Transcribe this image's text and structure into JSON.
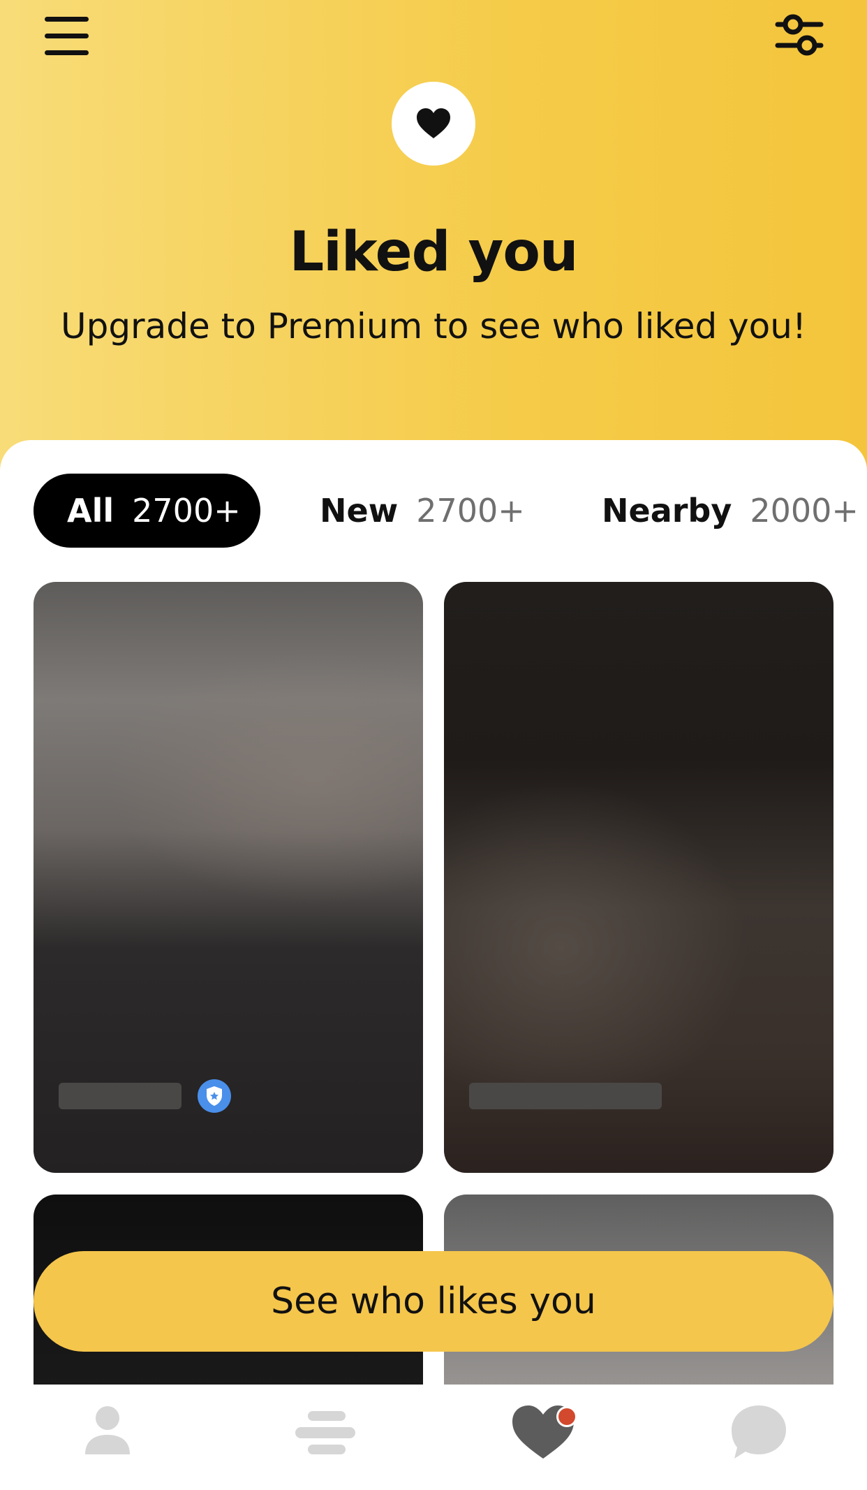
{
  "header": {
    "title": "Liked you",
    "subtitle": "Upgrade to Premium to see who liked you!",
    "menu_icon": "hamburger-menu-icon",
    "filter_icon": "sliders-filter-icon",
    "heart_icon": "heart-icon"
  },
  "tabs": [
    {
      "label": "All",
      "count": "2700+",
      "active": true
    },
    {
      "label": "New",
      "count": "2700+",
      "active": false
    },
    {
      "label": "Nearby",
      "count": "2000+",
      "active": false
    }
  ],
  "cards": [
    {
      "blurred": true,
      "verified": true
    },
    {
      "blurred": true,
      "verified": false
    },
    {
      "blurred": true,
      "verified": false
    },
    {
      "blurred": true,
      "verified": false
    }
  ],
  "cta": {
    "label": "See who likes you"
  },
  "bottom_nav": [
    {
      "icon": "profile-icon"
    },
    {
      "icon": "discover-stack-icon"
    },
    {
      "icon": "liked-you-heart-icon",
      "notification": true
    },
    {
      "icon": "chat-bubble-icon"
    }
  ],
  "colors": {
    "accent": "#f5c64c",
    "header_gradient_start": "#f8dc78",
    "header_gradient_end": "#f4c53c",
    "verified_badge": "#4a8fea",
    "notification_dot": "#d2492d"
  }
}
